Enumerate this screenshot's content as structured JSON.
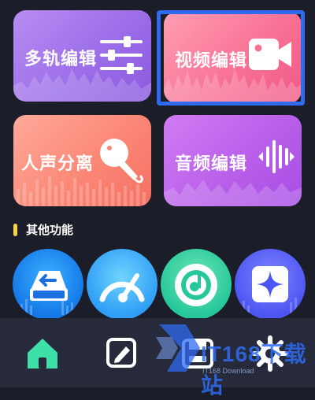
{
  "cards": {
    "multitrack": {
      "label": "多轨编辑",
      "icon": "sliders-icon",
      "color": "#9a6ce8"
    },
    "video": {
      "label": "视频编辑",
      "icon": "video-camera-icon",
      "color": "#f86f93"
    },
    "vocal": {
      "label": "人声分离",
      "icon": "microphone-icon",
      "color": "#fb8574"
    },
    "audio": {
      "label": "音频编辑",
      "icon": "audio-bars-icon",
      "color": "#b75de9"
    }
  },
  "highlight_color": "#2f6bf0",
  "section": {
    "title": "其他功能",
    "accent": "#ffd33a"
  },
  "functions": [
    {
      "icon": "disk-drive-icon"
    },
    {
      "icon": "speedometer-icon"
    },
    {
      "icon": "music-disc-icon"
    },
    {
      "icon": "sparkle-icon"
    }
  ],
  "tabbar": {
    "items": [
      {
        "icon": "home-icon",
        "active": true,
        "color": "#3fe0a8"
      },
      {
        "icon": "edit-doc-icon"
      },
      {
        "icon": "folder-save-icon"
      },
      {
        "icon": "settings-gear-icon"
      }
    ]
  },
  "watermark": {
    "title": "IT168下载站",
    "subtitle": "IT168 Download"
  }
}
